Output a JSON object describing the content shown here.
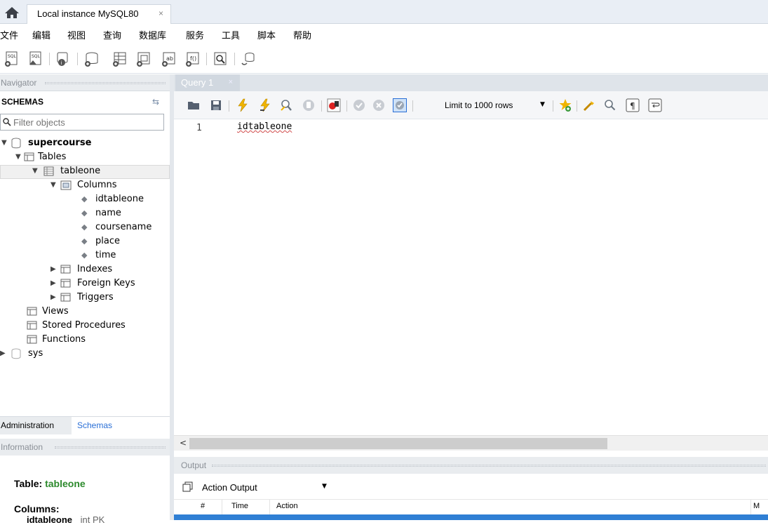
{
  "tabbar": {
    "connection_tab": "Local instance MySQL80",
    "close": "×"
  },
  "menu": [
    "文件",
    "编辑",
    "视图",
    "查询",
    "数据库",
    "服务",
    "工具",
    "脚本",
    "帮助"
  ],
  "navigator": {
    "header": "Navigator",
    "schemas_label": "SCHEMAS",
    "filter_placeholder": "Filter objects",
    "tree": {
      "schema1": "supercourse",
      "tables": "Tables",
      "table1": "tableone",
      "columns": "Columns",
      "cols": [
        "idtableone",
        "name",
        "coursename",
        "place",
        "time"
      ],
      "indexes": "Indexes",
      "foreign_keys": "Foreign Keys",
      "triggers": "Triggers",
      "views": "Views",
      "stored_procedures": "Stored Procedures",
      "functions": "Functions",
      "schema2": "sys"
    },
    "bottom_tabs": {
      "administration": "Administration",
      "schemas": "Schemas"
    }
  },
  "information": {
    "header": "Information",
    "table_label": "Table:",
    "table_value": "tableone",
    "columns_label": "Columns:",
    "first_col": "idtableone",
    "first_col_type": "int PK"
  },
  "query": {
    "tab_label": "Query 1",
    "limit_label": "Limit to 1000 rows",
    "line_number": "1",
    "code": "idtableone"
  },
  "output": {
    "header": "Output",
    "selector": "Action Output",
    "columns": [
      "#",
      "Time",
      "Action",
      "M"
    ]
  },
  "colors": {
    "accent_blue": "#2a6fd6",
    "green": "#2c8a2c",
    "selected_row": "#2f7fd4"
  }
}
